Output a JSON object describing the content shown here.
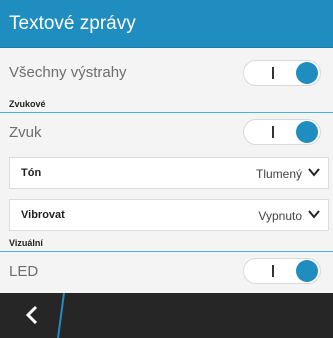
{
  "header": {
    "title": "Textové zprávy"
  },
  "rows": {
    "all_alerts": {
      "label": "Všechny výstrahy",
      "toggle_on": true
    },
    "sound": {
      "label": "Zvuk",
      "toggle_on": true
    },
    "led": {
      "label": "LED",
      "toggle_on": true
    }
  },
  "sections": {
    "sound": "Zvukové",
    "visual": "Vizuální"
  },
  "dropdowns": {
    "tone": {
      "label": "Tón",
      "value": "Tlumený"
    },
    "vibrate": {
      "label": "Vibrovat",
      "value": "Vypnuto"
    }
  },
  "colors": {
    "accent": "#1f8dbf",
    "bottombar": "#262626"
  },
  "icons": {
    "back": "back-icon",
    "chevron": "chevron-down-icon"
  }
}
